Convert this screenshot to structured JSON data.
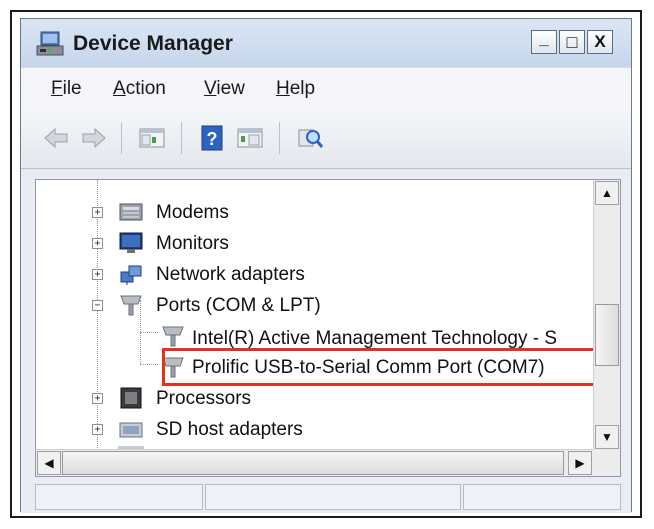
{
  "window": {
    "title": "Device Manager",
    "controls": {
      "minimize": "_",
      "maximize": "□",
      "close": "X"
    }
  },
  "menu": [
    {
      "label": "File",
      "accel": "F",
      "rest": "ile"
    },
    {
      "label": "Action",
      "accel": "A",
      "rest": "ction"
    },
    {
      "label": "View",
      "accel": "V",
      "rest": "iew"
    },
    {
      "label": "Help",
      "accel": "H",
      "rest": "elp"
    }
  ],
  "toolbar": {
    "buttons": [
      "back-arrow-icon",
      "forward-arrow-icon",
      "console-tree-icon",
      "help-icon",
      "properties-pane-icon",
      "scan-hardware-icon"
    ],
    "help_glyph": "?"
  },
  "tree": {
    "items": [
      {
        "label": "Modems",
        "expander": "+",
        "icon": "modem-icon"
      },
      {
        "label": "Monitors",
        "expander": "+",
        "icon": "monitor-icon"
      },
      {
        "label": "Network adapters",
        "expander": "+",
        "icon": "network-adapter-icon"
      },
      {
        "label": "Ports (COM & LPT)",
        "expander": "−",
        "icon": "port-icon"
      },
      {
        "label": "Intel(R) Active Management Technology - S",
        "icon": "port-connector-icon"
      },
      {
        "label": "Prolific USB-to-Serial Comm Port (COM7)",
        "icon": "port-connector-icon",
        "highlighted": true
      },
      {
        "label": "Processors",
        "expander": "+",
        "icon": "processor-icon"
      },
      {
        "label": "SD host adapters",
        "expander": "+",
        "icon": "sd-host-icon"
      }
    ]
  },
  "scroll": {
    "up": "▲",
    "down": "▼",
    "left": "◀",
    "right": "▶"
  },
  "colors": {
    "highlight_border": "#e4301f",
    "title_bar": "#c5d6ec"
  }
}
